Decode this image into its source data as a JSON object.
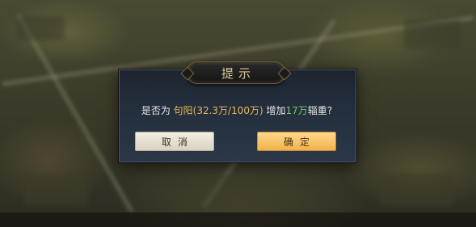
{
  "dialog": {
    "title": "提示",
    "message": {
      "prefix": "是否为 ",
      "city": "句阳(32.3万/100万)",
      "middle": " 增加",
      "amount": "17万",
      "suffix": "辎重?"
    },
    "buttons": {
      "cancel_label": "取消",
      "confirm_label": "确定"
    }
  },
  "colors": {
    "highlight_gold": "#e3b65a",
    "highlight_green": "#6fd06a",
    "confirm_button": "#f0b24a",
    "cancel_button": "#e6e0cf"
  }
}
